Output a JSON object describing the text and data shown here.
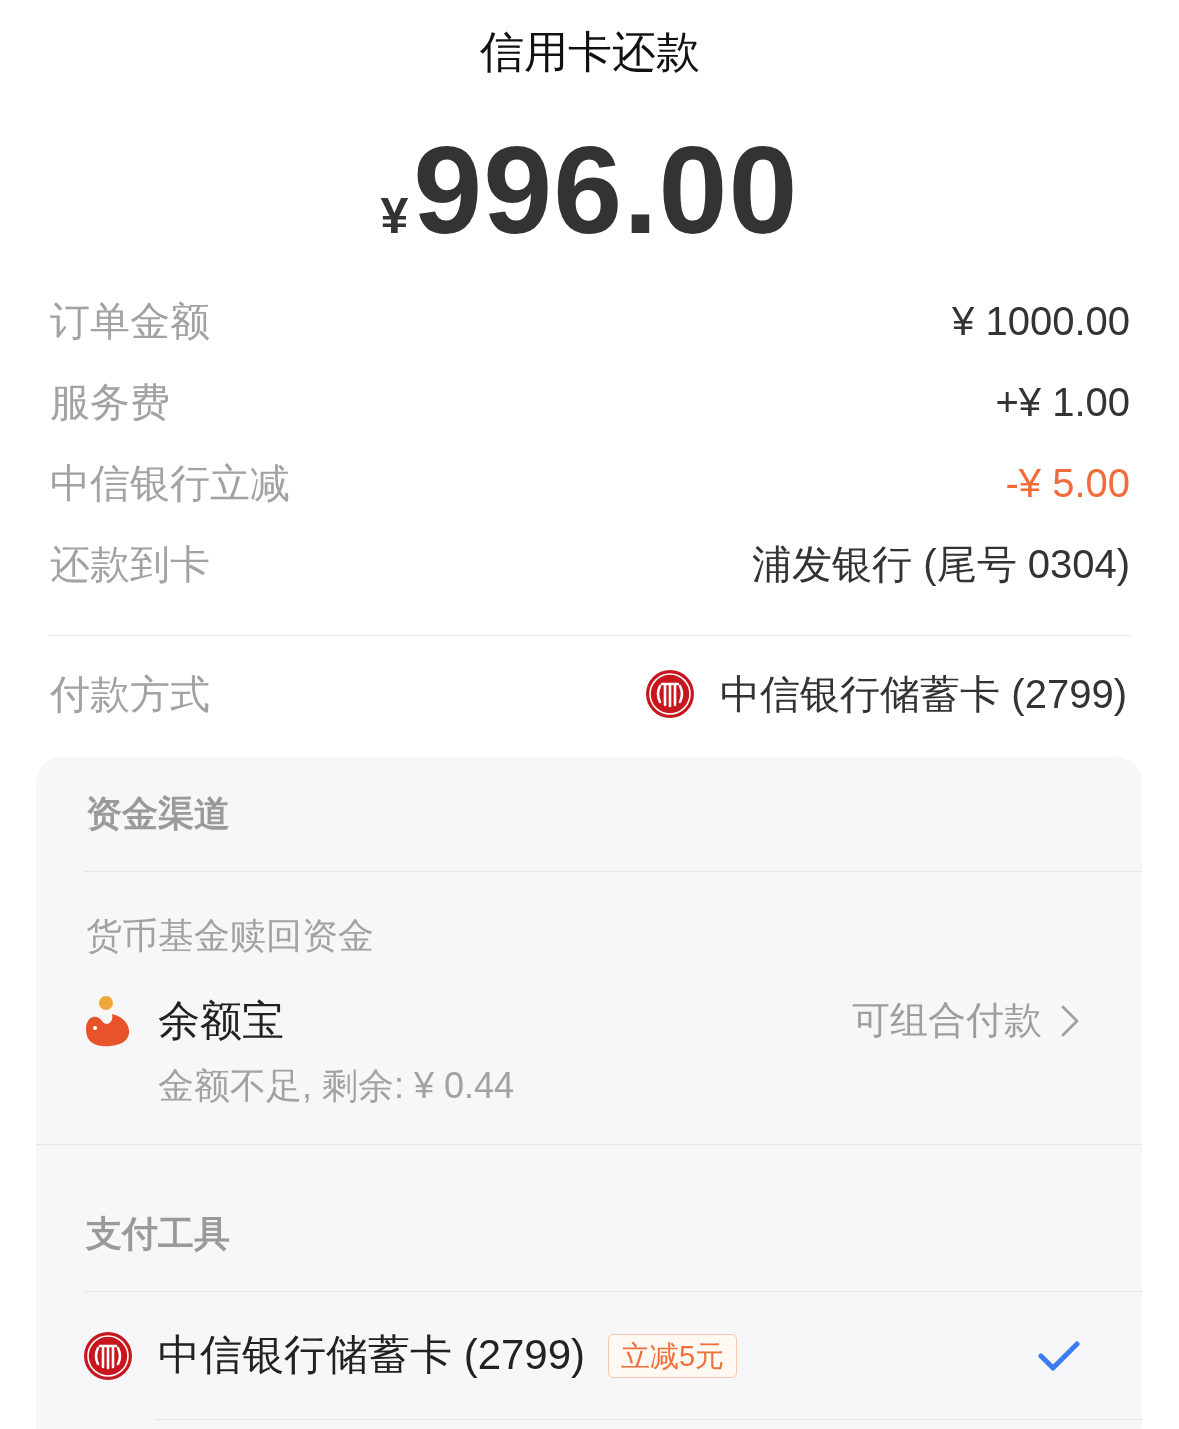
{
  "header": {
    "title": "信用卡还款"
  },
  "amount": {
    "currency": "¥",
    "value": "996.00"
  },
  "details": [
    {
      "label": "订单金额",
      "value": "¥ 1000.00",
      "kind": "plain"
    },
    {
      "label": "服务费",
      "value": "+¥ 1.00",
      "kind": "plain"
    },
    {
      "label": "中信银行立减",
      "value": "-¥ 5.00",
      "kind": "discount"
    },
    {
      "label": "还款到卡",
      "value": "浦发银行 (尾号 0304)",
      "kind": "plain"
    }
  ],
  "payment_method": {
    "label": "付款方式",
    "value": "中信银行储蓄卡 (2799)"
  },
  "fund_channels": {
    "heading": "资金渠道",
    "subheading": "货币基金赎回资金",
    "items": [
      {
        "name": "余额宝",
        "note": "金额不足, 剩余: ¥ 0.44",
        "action": "可组合付款"
      }
    ]
  },
  "payment_tools": {
    "heading": "支付工具",
    "items": [
      {
        "name": "中信银行储蓄卡 (2799)",
        "badge": "立减5元",
        "selected": true
      }
    ]
  }
}
